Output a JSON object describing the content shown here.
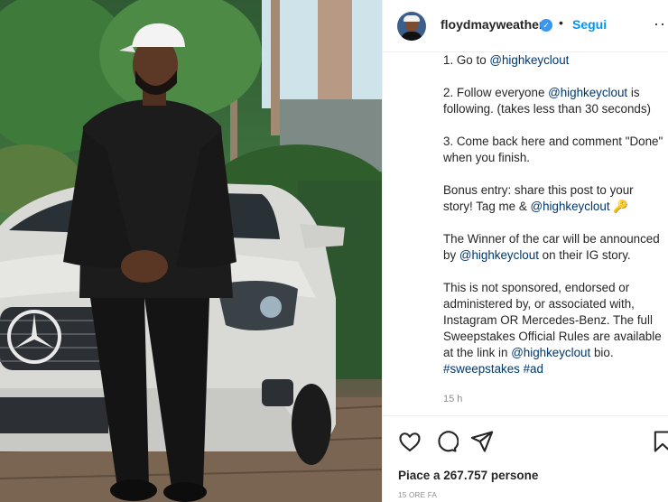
{
  "header": {
    "username": "floydmayweather",
    "verified_glyph": "✓",
    "separator": "•",
    "follow_label": "Segui",
    "more_glyph": "···"
  },
  "caption": {
    "step1": {
      "text": "1. Go to ",
      "mention": "@highkeyclout"
    },
    "step2": {
      "text1": "2. Follow everyone ",
      "mention": "@highkeyclout",
      "text2": " is",
      "line2": "following. (takes less than 30 seconds)"
    },
    "step3": {
      "line1": "3. Come back here and comment \"Done\"",
      "line2": "when you finish."
    },
    "bonus": {
      "line1": "Bonus entry: share this post to your",
      "line2_text": "story! Tag me & ",
      "mention": "@highkeyclout",
      "emoji": "🔑"
    },
    "winner": {
      "line1": "The Winner of the car will be announced",
      "line2_text": "by ",
      "mention": "@highkeyclout",
      "line2_tail": " on their IG story."
    },
    "legal": {
      "line1": "This is not sponsored, endorsed or",
      "line2": "administered by, or associated with,",
      "line3": "Instagram OR Mercedes-Benz. The full",
      "line4": "Sweepstakes Official Rules are available",
      "line5_text": "at the link in ",
      "mention": "@highkeyclout",
      "line5_tail": " bio.",
      "tag1": "#sweepstakes",
      "tag2": "#ad"
    }
  },
  "time_ago": "15 h",
  "actions": {
    "like_icon": "heart-icon",
    "comment_icon": "comment-icon",
    "share_icon": "paper-plane-icon",
    "save_icon": "bookmark-icon"
  },
  "likes_text": "Piace a 267.757 persone",
  "date_ago": "15 ORE FA",
  "colors": {
    "link": "#0095f6",
    "mention": "#00376b",
    "muted": "#8e8e8e",
    "verified": "#3897f0"
  }
}
